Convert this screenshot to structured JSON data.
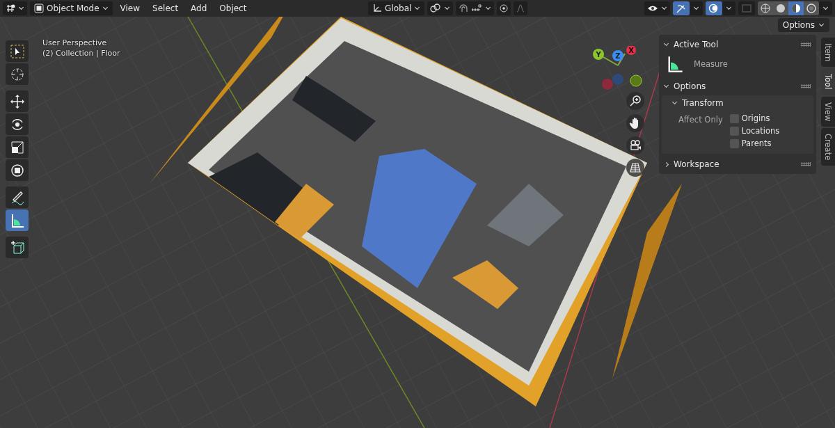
{
  "header": {
    "mode": "Object Mode",
    "menus": [
      "View",
      "Select",
      "Add",
      "Object"
    ],
    "orientation": "Global",
    "gizmos_on": true,
    "overlays_on": true,
    "shading": [
      {
        "kind": "wire",
        "selected": false
      },
      {
        "kind": "solid",
        "selected": false
      },
      {
        "kind": "material",
        "selected": true
      },
      {
        "kind": "rendered",
        "selected": false
      }
    ]
  },
  "options_button": "Options",
  "viewport_info": [
    "User Perspective",
    "(2) Collection | Floor"
  ],
  "toolbar": [
    {
      "kind": "select",
      "selected": false
    },
    {
      "kind": "cursor",
      "selected": false
    },
    {
      "kind": "move",
      "selected": false
    },
    {
      "kind": "rotate",
      "selected": false
    },
    {
      "kind": "scale",
      "selected": false
    },
    {
      "kind": "transform",
      "selected": false
    },
    {
      "kind": "annotate",
      "selected": false
    },
    {
      "kind": "measure",
      "selected": true
    },
    {
      "kind": "add-cube",
      "selected": false
    }
  ],
  "gizmo": {
    "x": "X",
    "y": "Y",
    "z": "Z"
  },
  "sidebar": {
    "active_tool": {
      "title": "Active Tool",
      "expanded": true,
      "tool": "Measure"
    },
    "options": {
      "title": "Options",
      "expanded": true,
      "transform": {
        "title": "Transform",
        "expanded": true,
        "label": "Affect Only",
        "checkboxes": [
          {
            "label": "Origins",
            "checked": false
          },
          {
            "label": "Locations",
            "checked": false
          },
          {
            "label": "Parents",
            "checked": false
          }
        ]
      }
    },
    "workspace": {
      "title": "Workspace",
      "expanded": false
    },
    "tabs": [
      {
        "label": "Item",
        "selected": false
      },
      {
        "label": "Tool",
        "selected": true
      },
      {
        "label": "View",
        "selected": false
      },
      {
        "label": "Create",
        "selected": false
      }
    ]
  }
}
